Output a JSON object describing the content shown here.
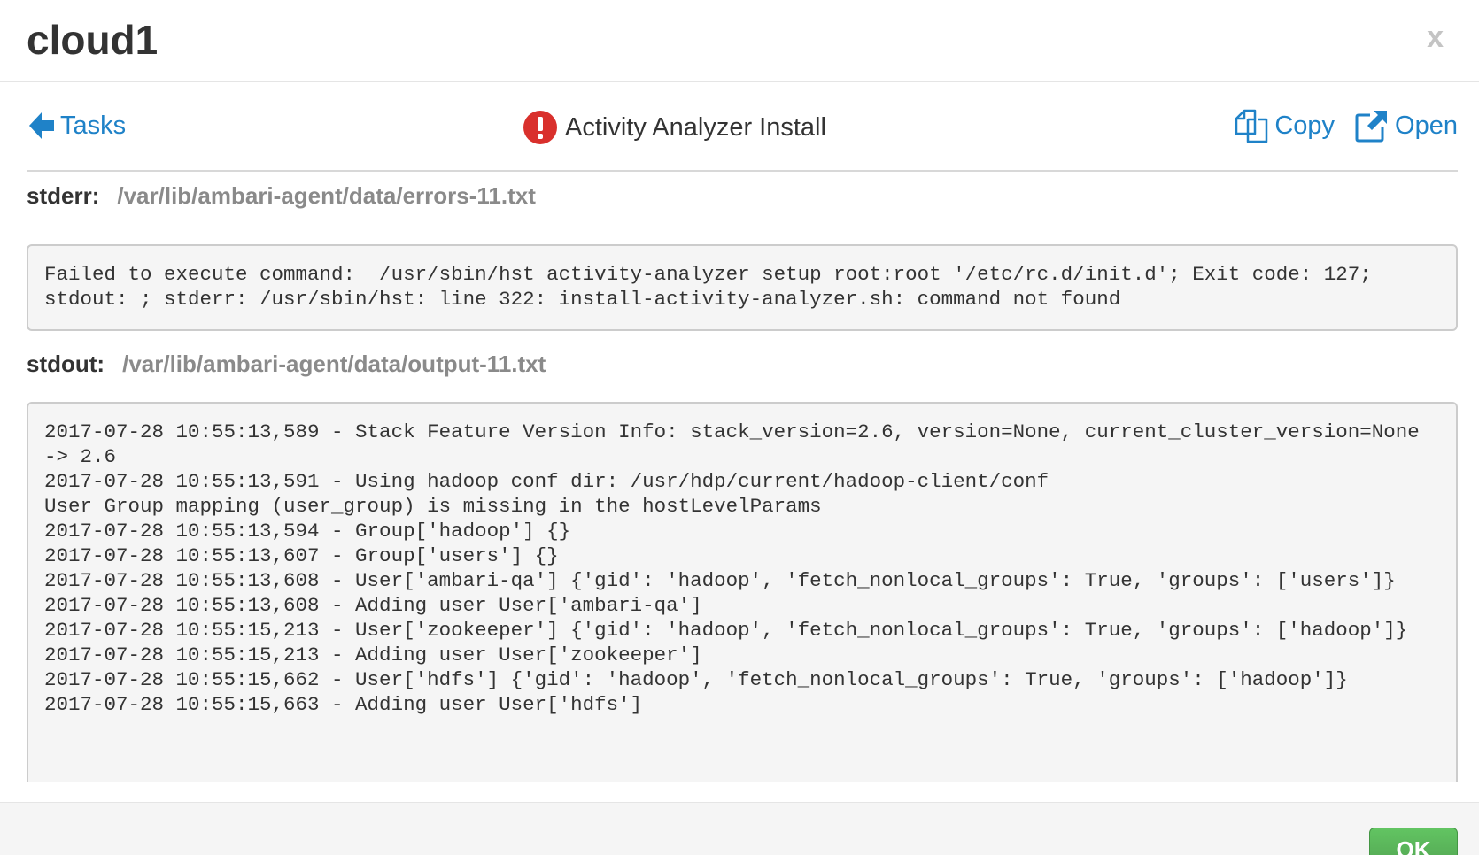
{
  "modal": {
    "title": "cloud1",
    "close_label": "x"
  },
  "toolbar": {
    "back_label": "Tasks",
    "task_title": "Activity Analyzer Install",
    "task_status": "failed",
    "copy_label": "Copy",
    "open_label": "Open"
  },
  "stderr": {
    "label": "stderr:",
    "path": "/var/lib/ambari-agent/data/errors-11.txt",
    "content": "Failed to execute command:  /usr/sbin/hst activity-analyzer setup root:root '/etc/rc.d/init.d'; Exit code: 127; stdout: ; stderr: /usr/sbin/hst: line 322: install-activity-analyzer.sh: command not found"
  },
  "stdout": {
    "label": "stdout:",
    "path": "/var/lib/ambari-agent/data/output-11.txt",
    "content": "2017-07-28 10:55:13,589 - Stack Feature Version Info: stack_version=2.6, version=None, current_cluster_version=None -> 2.6\n2017-07-28 10:55:13,591 - Using hadoop conf dir: /usr/hdp/current/hadoop-client/conf\nUser Group mapping (user_group) is missing in the hostLevelParams\n2017-07-28 10:55:13,594 - Group['hadoop'] {}\n2017-07-28 10:55:13,607 - Group['users'] {}\n2017-07-28 10:55:13,608 - User['ambari-qa'] {'gid': 'hadoop', 'fetch_nonlocal_groups': True, 'groups': ['users']}\n2017-07-28 10:55:13,608 - Adding user User['ambari-qa']\n2017-07-28 10:55:15,213 - User['zookeeper'] {'gid': 'hadoop', 'fetch_nonlocal_groups': True, 'groups': ['hadoop']}\n2017-07-28 10:55:15,213 - Adding user User['zookeeper']\n2017-07-28 10:55:15,662 - User['hdfs'] {'gid': 'hadoop', 'fetch_nonlocal_groups': True, 'groups': ['hadoop']}\n2017-07-28 10:55:15,663 - Adding user User['hdfs']"
  },
  "footer": {
    "ok_label": "OK"
  },
  "colors": {
    "link": "#1f82c8",
    "error": "#d9302c",
    "ok_button": "#51a351"
  }
}
